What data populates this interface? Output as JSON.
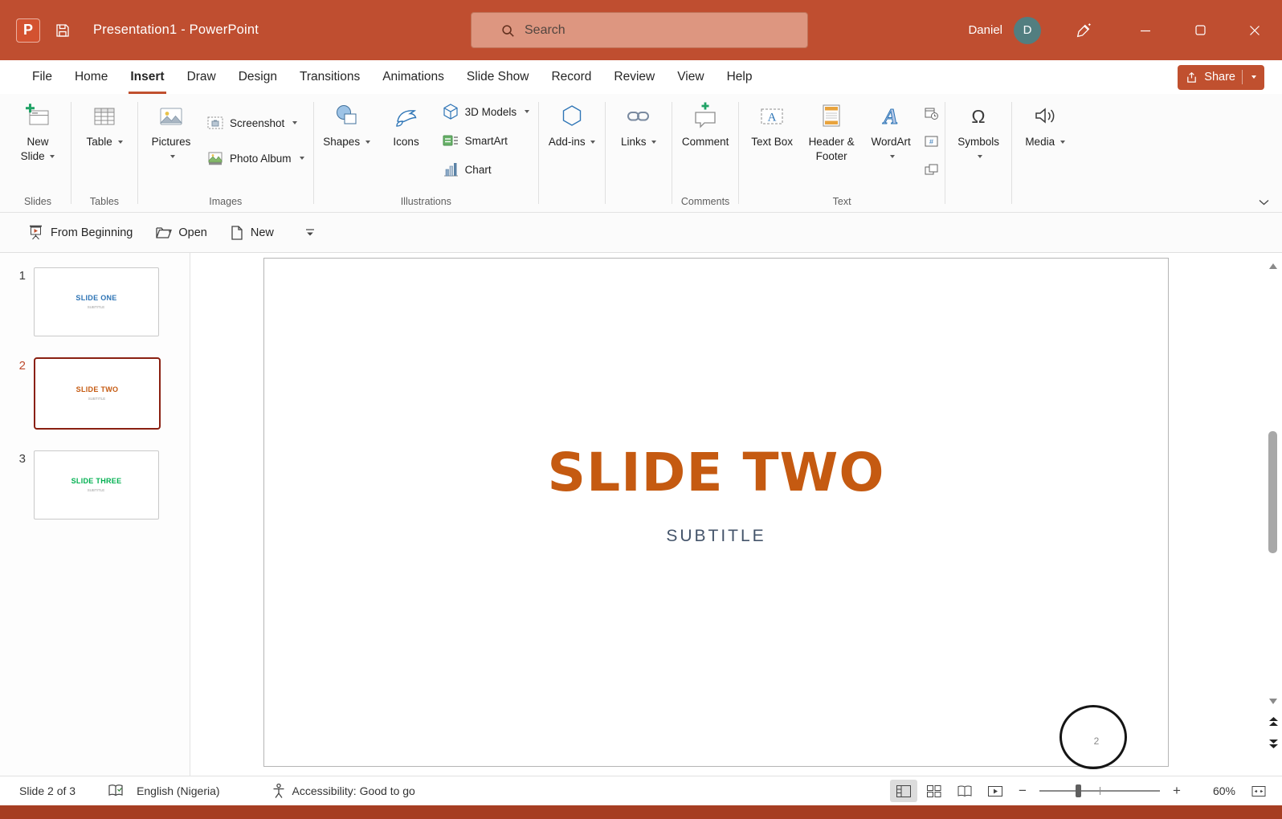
{
  "titlebar": {
    "app_title": "Presentation1  -  PowerPoint",
    "search_placeholder": "Search",
    "user_name": "Daniel",
    "user_initial": "D"
  },
  "menubar": {
    "tabs": [
      "File",
      "Home",
      "Insert",
      "Draw",
      "Design",
      "Transitions",
      "Animations",
      "Slide Show",
      "Record",
      "Review",
      "View",
      "Help"
    ],
    "active_tab": "Insert",
    "share": "Share"
  },
  "ribbon": {
    "buttons": {
      "new_slide": "New Slide",
      "table": "Table",
      "pictures": "Pictures",
      "screenshot": "Screenshot",
      "photo_album": "Photo Album",
      "shapes": "Shapes",
      "icons": "Icons",
      "three_d_models": "3D Models",
      "smartart": "SmartArt",
      "chart": "Chart",
      "add_ins": "Add-ins",
      "links": "Links",
      "comment": "Comment",
      "text_box": "Text Box",
      "header_footer": "Header & Footer",
      "wordart": "WordArt",
      "symbols": "Symbols",
      "media": "Media"
    },
    "groups": {
      "slides": "Slides",
      "tables": "Tables",
      "images": "Images",
      "illustrations": "Illustrations",
      "comments": "Comments",
      "text": "Text"
    }
  },
  "quickbar": {
    "from_beginning": "From Beginning",
    "open": "Open",
    "new": "New"
  },
  "thumbnails": [
    {
      "num": "1",
      "title": "SLIDE ONE",
      "subtitle": "SUBTITLE",
      "title_color": "#2E74B5"
    },
    {
      "num": "2",
      "title": "SLIDE TWO",
      "subtitle": "SUBTITLE",
      "title_color": "#C55A11"
    },
    {
      "num": "3",
      "title": "SLIDE THREE",
      "subtitle": "SUBTITLE",
      "title_color": "#00B050"
    }
  ],
  "slide": {
    "title": "SLIDE TWO",
    "subtitle": "SUBTITLE",
    "page_number": "2",
    "title_color": "#C55A11",
    "subtitle_color": "#44546A"
  },
  "statusbar": {
    "slide_indicator": "Slide 2 of 3",
    "language": "English (Nigeria)",
    "accessibility": "Accessibility: Good to go",
    "zoom_level": "60%"
  },
  "colors": {
    "brand_red": "#BF4E30",
    "accent_orange": "#C55A11",
    "selected_thumb_border": "#8A2011"
  }
}
